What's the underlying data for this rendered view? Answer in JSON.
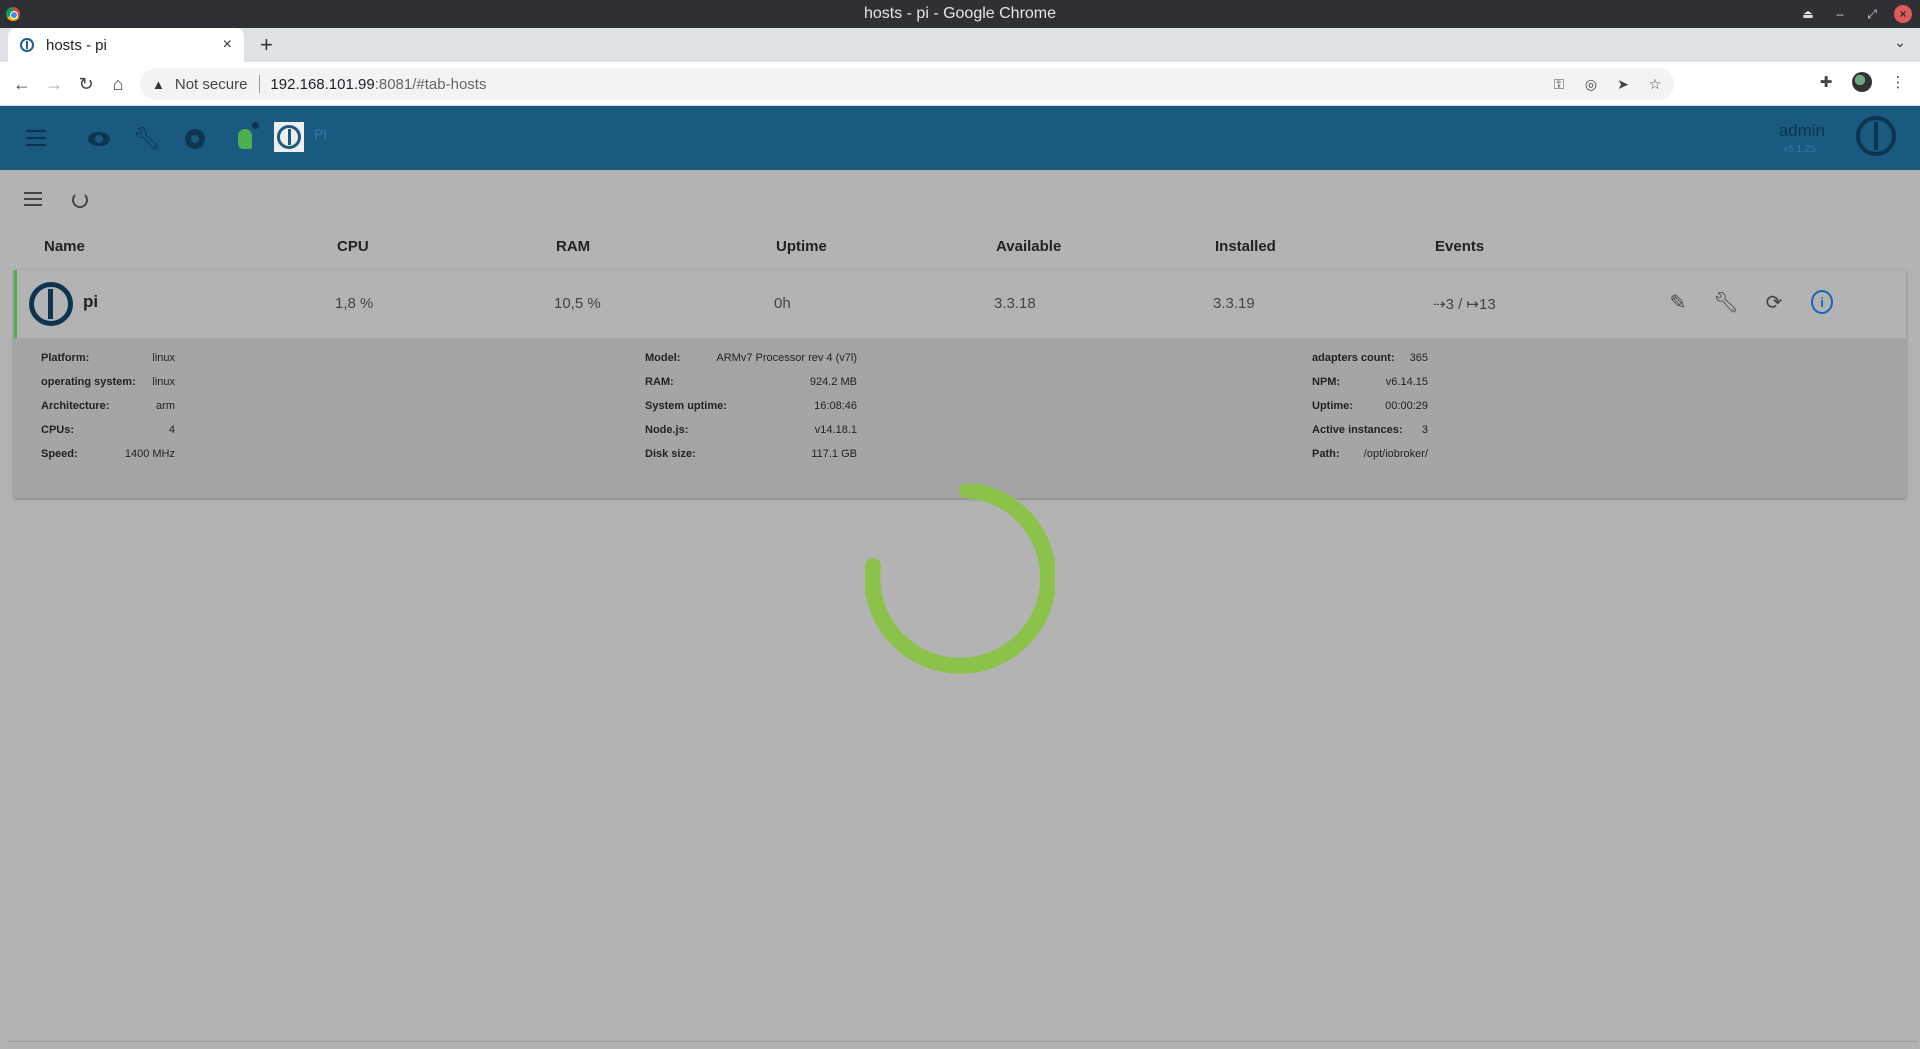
{
  "window": {
    "title": "hosts - pi - Google Chrome"
  },
  "browser": {
    "tab_title": "hosts - pi",
    "new_tab": "+",
    "tab_close": "×",
    "not_secure": "Not secure",
    "url_host": "192.168.101.99",
    "url_path": ":8081/#tab-hosts"
  },
  "app": {
    "host_label": "PI",
    "user_name": "admin",
    "version": "v5.1.25"
  },
  "table": {
    "headers": [
      "Name",
      "CPU",
      "RAM",
      "Uptime",
      "Available",
      "Installed",
      "Events"
    ],
    "row": {
      "name": "pi",
      "cpu": "1,8 %",
      "ram": "10,5 %",
      "uptime": "0h",
      "available": "3.3.18",
      "installed": "3.3.19",
      "events": "⇢3 / ↦13"
    }
  },
  "details": {
    "col1": [
      {
        "k": "Platform:",
        "v": "linux"
      },
      {
        "k": "operating system:",
        "v": "linux"
      },
      {
        "k": "Architecture:",
        "v": "arm"
      },
      {
        "k": "CPUs:",
        "v": "4"
      },
      {
        "k": "Speed:",
        "v": "1400 MHz"
      }
    ],
    "col2": [
      {
        "k": "Model:",
        "v": "ARMv7 Processor rev 4 (v7l)"
      },
      {
        "k": "RAM:",
        "v": "924.2 MB"
      },
      {
        "k": "System uptime:",
        "v": "16:08:46"
      },
      {
        "k": "Node.js:",
        "v": "v14.18.1"
      },
      {
        "k": "Disk size:",
        "v": "117.1 GB"
      }
    ],
    "col3": [
      {
        "k": "adapters count:",
        "v": "365"
      },
      {
        "k": "NPM:",
        "v": "v6.14.15"
      },
      {
        "k": "Uptime:",
        "v": "00:00:29"
      },
      {
        "k": "Active instances:",
        "v": "3"
      },
      {
        "k": "Path:",
        "v": "/opt/iobroker/"
      }
    ]
  },
  "colors": {
    "appbar": "#1a5a80",
    "accent_green": "#4caf50",
    "spinner": "#8bc34a",
    "info_blue": "#1565c0"
  }
}
